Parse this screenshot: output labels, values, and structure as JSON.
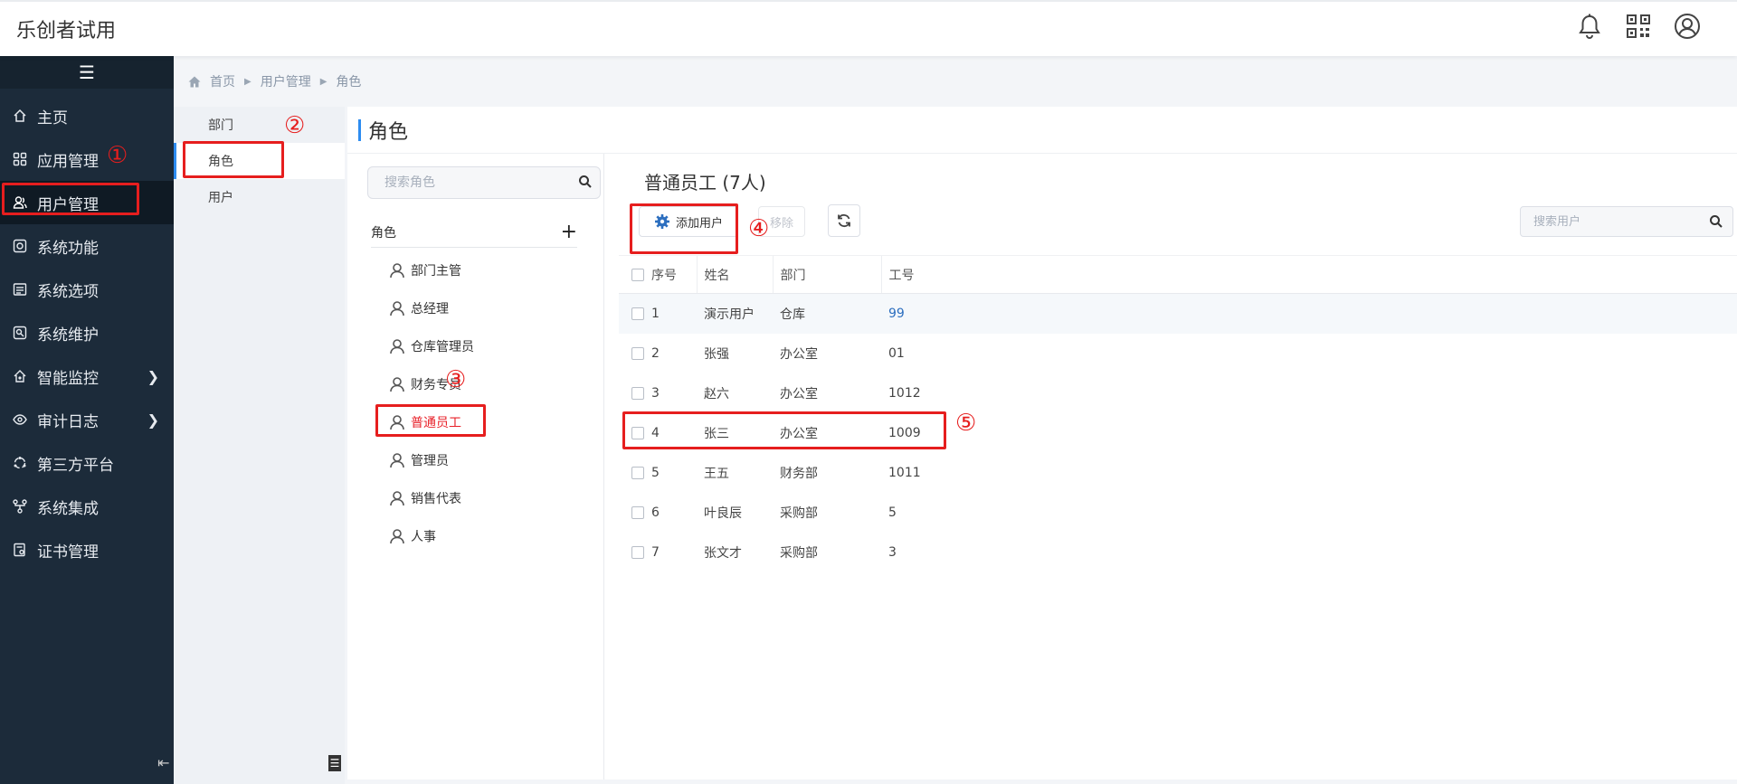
{
  "app": {
    "title": "乐创者试用"
  },
  "header_icons": [
    "bell-icon",
    "qrcode-icon",
    "user-circle-icon"
  ],
  "sidebar": {
    "toggle_glyph": "☰",
    "items": [
      {
        "label": "主页",
        "icon": "home-icon"
      },
      {
        "label": "应用管理",
        "icon": "apps-icon"
      },
      {
        "label": "用户管理",
        "icon": "users-icon",
        "active": true
      },
      {
        "label": "系统功能",
        "icon": "system-function-icon"
      },
      {
        "label": "系统选项",
        "icon": "options-icon"
      },
      {
        "label": "系统维护",
        "icon": "maintenance-icon"
      },
      {
        "label": "智能监控",
        "icon": "monitor-icon",
        "has_children": true
      },
      {
        "label": "审计日志",
        "icon": "eye-icon",
        "has_children": true
      },
      {
        "label": "第三方平台",
        "icon": "third-party-icon"
      },
      {
        "label": "系统集成",
        "icon": "integration-icon"
      },
      {
        "label": "证书管理",
        "icon": "certificate-icon"
      }
    ]
  },
  "breadcrumb": {
    "home": "首页",
    "level1": "用户管理",
    "level2": "角色"
  },
  "subnav": {
    "items": [
      {
        "label": "部门"
      },
      {
        "label": "角色",
        "active": true
      },
      {
        "label": "用户"
      }
    ],
    "collapse_glyph": "☰"
  },
  "main": {
    "title": "角色"
  },
  "roles": {
    "search_placeholder": "搜索角色",
    "header": "角色",
    "add_glyph": "+",
    "items": [
      {
        "label": "部门主管"
      },
      {
        "label": "总经理"
      },
      {
        "label": "仓库管理员"
      },
      {
        "label": "财务专员"
      },
      {
        "label": "普通员工",
        "selected": true
      },
      {
        "label": "管理员"
      },
      {
        "label": "销售代表"
      },
      {
        "label": "人事"
      }
    ]
  },
  "users": {
    "title": "普通员工 (7人)",
    "add_button": "添加用户",
    "remove_button": "移除",
    "search_placeholder": "搜索用户",
    "columns": {
      "no": "序号",
      "name": "姓名",
      "dept": "部门",
      "id": "工号"
    },
    "rows": [
      {
        "no": "1",
        "name": "演示用户",
        "dept": "仓库",
        "id": "99"
      },
      {
        "no": "2",
        "name": "张强",
        "dept": "办公室",
        "id": "01"
      },
      {
        "no": "3",
        "name": "赵六",
        "dept": "办公室",
        "id": "1012"
      },
      {
        "no": "4",
        "name": "张三",
        "dept": "办公室",
        "id": "1009"
      },
      {
        "no": "5",
        "name": "王五",
        "dept": "财务部",
        "id": "1011"
      },
      {
        "no": "6",
        "name": "叶良辰",
        "dept": "采购部",
        "id": "5"
      },
      {
        "no": "7",
        "name": "张文才",
        "dept": "采购部",
        "id": "3"
      }
    ]
  },
  "annotations": [
    "①",
    "②",
    "③",
    "④",
    "⑤"
  ],
  "colors": {
    "sidebar_bg": "#1c2b3a",
    "accent": "#2d8cf0",
    "annotation_red": "#e61e1e",
    "selected_role": "#e8222a",
    "link_blue": "#2d6fbf"
  }
}
